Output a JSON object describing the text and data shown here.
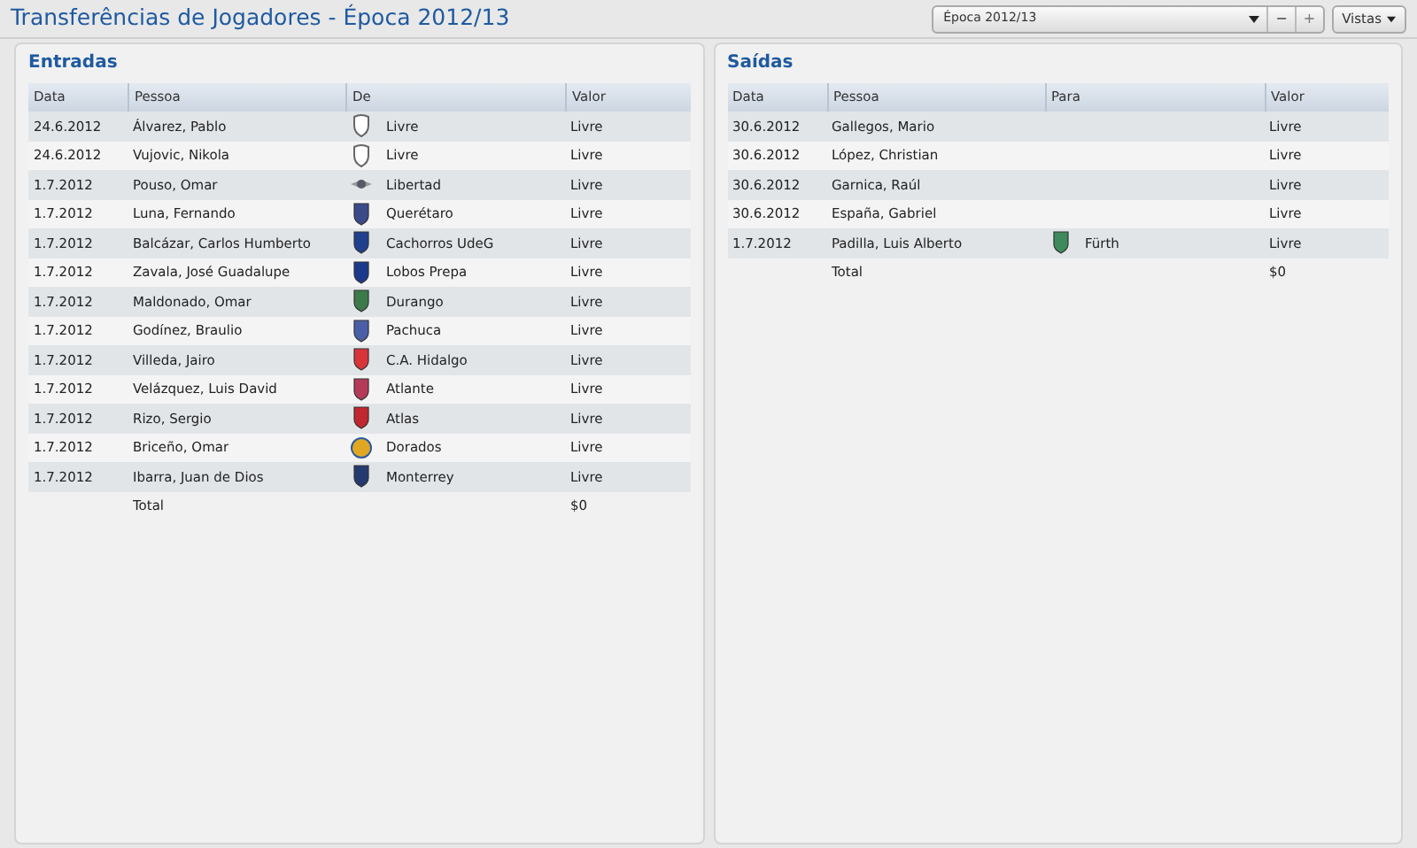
{
  "title": "Transferências de Jogadores - Época 2012/13",
  "season_select": {
    "value": "Época 2012/13",
    "minus": "−",
    "plus": "+"
  },
  "views_button": {
    "label": "Vistas"
  },
  "panels": [
    {
      "title": "Entradas",
      "columns": [
        "Data",
        "Pessoa",
        "De",
        "Valor"
      ],
      "rows": [
        {
          "date": "24.6.2012",
          "person": "Álvarez, Pablo",
          "club": {
            "name": "Livre",
            "kind": "outline",
            "color": "#ffffff"
          },
          "value": "Livre"
        },
        {
          "date": "24.6.2012",
          "person": "Vujovic, Nikola",
          "club": {
            "name": "Livre",
            "kind": "outline",
            "color": "#ffffff"
          },
          "value": "Livre"
        },
        {
          "date": "1.7.2012",
          "person": "Pouso, Omar",
          "club": {
            "name": "Libertad",
            "kind": "wings",
            "color": "#555a66"
          },
          "value": "Livre"
        },
        {
          "date": "1.7.2012",
          "person": "Luna, Fernando",
          "club": {
            "name": "Querétaro",
            "kind": "shield",
            "color": "#3b4a8a"
          },
          "value": "Livre"
        },
        {
          "date": "1.7.2012",
          "person": "Balcázar, Carlos Humberto",
          "club": {
            "name": "Cachorros UdeG",
            "kind": "shield",
            "color": "#1f3f8f"
          },
          "value": "Livre"
        },
        {
          "date": "1.7.2012",
          "person": "Zavala, José Guadalupe",
          "club": {
            "name": "Lobos Prepa",
            "kind": "shield",
            "color": "#1c3a8c"
          },
          "value": "Livre"
        },
        {
          "date": "1.7.2012",
          "person": "Maldonado, Omar",
          "club": {
            "name": "Durango",
            "kind": "shield",
            "color": "#3d7a4a"
          },
          "value": "Livre"
        },
        {
          "date": "1.7.2012",
          "person": "Godínez, Braulio",
          "club": {
            "name": "Pachuca",
            "kind": "shield",
            "color": "#4a5fa8"
          },
          "value": "Livre"
        },
        {
          "date": "1.7.2012",
          "person": "Villeda, Jairo",
          "club": {
            "name": "C.A. Hidalgo",
            "kind": "shield",
            "color": "#d8343a"
          },
          "value": "Livre"
        },
        {
          "date": "1.7.2012",
          "person": "Velázquez, Luis David",
          "club": {
            "name": "Atlante",
            "kind": "shield",
            "color": "#b53a5a"
          },
          "value": "Livre"
        },
        {
          "date": "1.7.2012",
          "person": "Rizo, Sergio",
          "club": {
            "name": "Atlas",
            "kind": "shield",
            "color": "#c2262e"
          },
          "value": "Livre"
        },
        {
          "date": "1.7.2012",
          "person": "Briceño, Omar",
          "club": {
            "name": "Dorados",
            "kind": "round",
            "color": "#e0a822"
          },
          "value": "Livre"
        },
        {
          "date": "1.7.2012",
          "person": "Ibarra, Juan de Dios",
          "club": {
            "name": "Monterrey",
            "kind": "shield",
            "color": "#233a70"
          },
          "value": "Livre"
        }
      ],
      "total": {
        "label": "Total",
        "value": "$0"
      }
    },
    {
      "title": "Saídas",
      "columns": [
        "Data",
        "Pessoa",
        "Para",
        "Valor"
      ],
      "rows": [
        {
          "date": "30.6.2012",
          "person": "Gallegos, Mario",
          "value": "Livre"
        },
        {
          "date": "30.6.2012",
          "person": "López, Christian",
          "value": "Livre"
        },
        {
          "date": "30.6.2012",
          "person": "Garnica, Raúl",
          "value": "Livre"
        },
        {
          "date": "30.6.2012",
          "person": "España, Gabriel",
          "value": "Livre"
        },
        {
          "date": "1.7.2012",
          "person": "Padilla, Luis Alberto",
          "club": {
            "name": "Fürth",
            "kind": "shield",
            "color": "#3e8a5c"
          },
          "value": "Livre"
        }
      ],
      "total": {
        "label": "Total",
        "value": "$0"
      }
    }
  ]
}
